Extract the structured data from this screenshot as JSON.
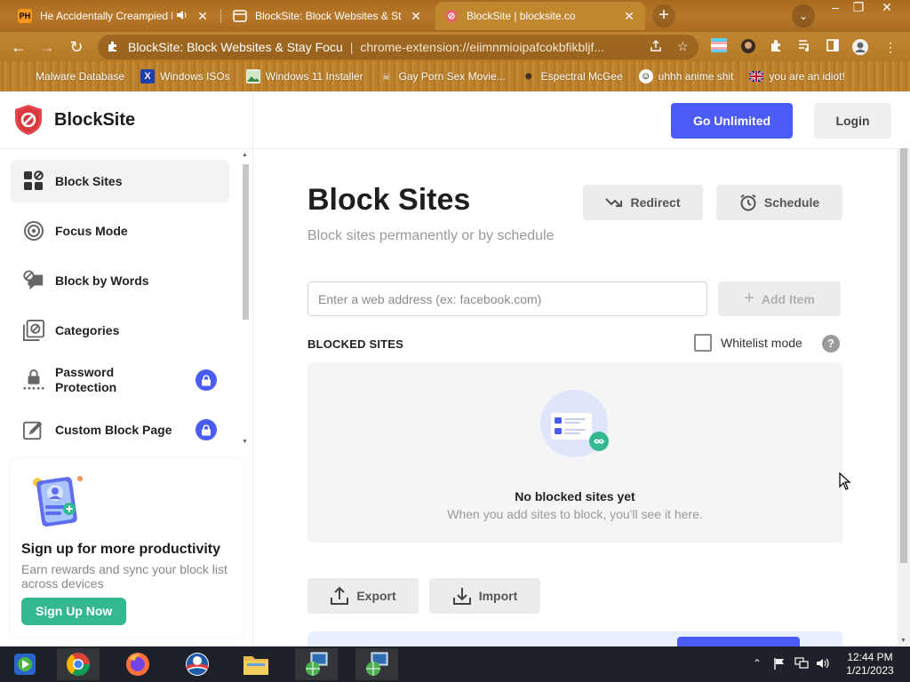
{
  "browser": {
    "tabs": [
      {
        "favicon": "PH",
        "title": "He Accidentally Creampied h",
        "audio": "speaker-icon"
      },
      {
        "favicon": "blocksite-icon",
        "title": "BlockSite: Block Websites & Stay F"
      },
      {
        "favicon": "blocksite-icon",
        "title": "BlockSite | blocksite.co"
      }
    ],
    "address_bar": {
      "site_name": "BlockSite: Block Websites & Stay Focu",
      "url": "chrome-extension://eiimnmioipafcokbfikbljf..."
    },
    "bookmarks": [
      {
        "icon": "globe-icon",
        "label": "Malware Database"
      },
      {
        "icon": "x-icon",
        "label": "Windows ISOs"
      },
      {
        "icon": "image-icon",
        "label": "Windows 11 Installer"
      },
      {
        "icon": "skull-icon",
        "label": "Gay Porn Sex Movie..."
      },
      {
        "icon": "face-icon",
        "label": "Espectral McGee"
      },
      {
        "icon": "anime-icon",
        "label": "uhhh anime shit"
      },
      {
        "icon": "flag-icon",
        "label": "you are an idiot!"
      }
    ]
  },
  "app": {
    "brand": "BlockSite",
    "header": {
      "go_unlimited": "Go Unlimited",
      "login": "Login"
    },
    "nav": [
      {
        "label": "Block Sites",
        "icon": "grid-blocks-icon",
        "active": true,
        "locked": false
      },
      {
        "label": "Focus Mode",
        "icon": "target-icon",
        "active": false,
        "locked": false
      },
      {
        "label": "Block by Words",
        "icon": "speech-block-icon",
        "active": false,
        "locked": false
      },
      {
        "label": "Categories",
        "icon": "categories-icon",
        "active": false,
        "locked": false
      },
      {
        "label": "Password Protection",
        "icon": "password-lock-icon",
        "active": false,
        "locked": true
      },
      {
        "label": "Custom Block Page",
        "icon": "custom-page-icon",
        "active": false,
        "locked": true
      }
    ],
    "promo": {
      "title": "Sign up for more productivity",
      "description": "Earn rewards and sync your block list across devices",
      "button": "Sign Up Now"
    },
    "main": {
      "title": "Block Sites",
      "subtitle": "Block sites permanently or by schedule",
      "redirect": "Redirect",
      "schedule": "Schedule",
      "input_placeholder": "Enter a web address (ex: facebook.com)",
      "add_item": "Add Item",
      "blocked_sites_label": "BLOCKED SITES",
      "whitelist_label": "Whitelist mode",
      "help": "?",
      "empty_title": "No blocked sites yet",
      "empty_desc": "When you add sites to block, you'll see it here.",
      "export": "Export",
      "import": "Import"
    },
    "colors": {
      "accent": "#4b5bf5",
      "brand_red": "#e5474b",
      "signup_green": "#33b890"
    }
  },
  "taskbar": {
    "apps": [
      "windows-media-icon",
      "chrome-icon",
      "firefox-icon",
      "obama-icon",
      "file-explorer-icon",
      "network-icon",
      "network-icon"
    ],
    "time": "12:44 PM",
    "date": "1/21/2023"
  }
}
